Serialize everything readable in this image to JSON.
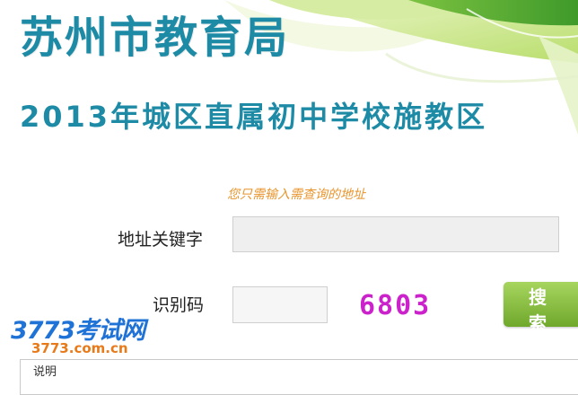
{
  "header": {
    "org_title": "苏州市教育局",
    "sub_title": "2013年城区直属初中学校施教区"
  },
  "form": {
    "hint": "您只需输入需查询的地址",
    "address_label": "地址关键字",
    "address_value": "",
    "code_label": "识别码",
    "code_value": "",
    "captcha_text": "6803",
    "search_label": "搜 索"
  },
  "info": {
    "label": "说明"
  },
  "watermark": {
    "logo_text": "3773考试网",
    "url_text": "3773.com.cn"
  },
  "colors": {
    "title": "#1d8aa6",
    "hint": "#e8952d",
    "button": "#82b83a",
    "captcha": "#cc22cc",
    "watermark_logo": "#1f72d6",
    "watermark_url": "#e87a1a"
  }
}
